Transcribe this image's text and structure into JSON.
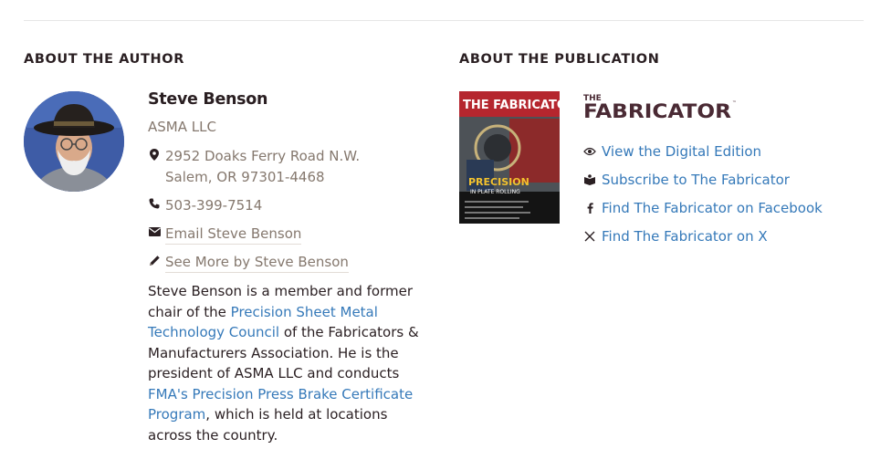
{
  "author_section": {
    "heading": "ABOUT THE AUTHOR",
    "name": "Steve Benson",
    "company": "ASMA LLC",
    "address_line1": "2952 Doaks Ferry Road N.W.",
    "address_line2": "Salem, OR 97301-4468",
    "phone": "503-399-7514",
    "email_link": "Email Steve Benson",
    "more_link": "See More by Steve Benson",
    "bio": {
      "part1": "Steve Benson is a member and former chair of the ",
      "link1": "Precision Sheet Metal Technology Council",
      "part2": " of the Fabricators & Manufacturers Association. He is the president of ASMA LLC and conducts ",
      "link2": "FMA's Precision Press Brake Certificate Program",
      "part3": ", which is held at locations across the country."
    }
  },
  "publication_section": {
    "heading": "ABOUT THE PUBLICATION",
    "logo_text": "THE FABRICATOR",
    "cover": {
      "masthead": "THE FABRICATOR",
      "headline": "PRECISION",
      "subheadline": "IN PLATE ROLLING"
    },
    "links": [
      {
        "icon": "eye-icon",
        "label": "View the Digital Edition"
      },
      {
        "icon": "book-icon",
        "label": "Subscribe to The Fabricator"
      },
      {
        "icon": "facebook-icon",
        "label": "Find The Fabricator on Facebook"
      },
      {
        "icon": "x-icon",
        "label": "Find The Fabricator on X"
      }
    ]
  },
  "colors": {
    "heading": "#2a1f22",
    "muted_text": "#85786e",
    "link": "#3579b9",
    "logo": "#4a2a34"
  }
}
